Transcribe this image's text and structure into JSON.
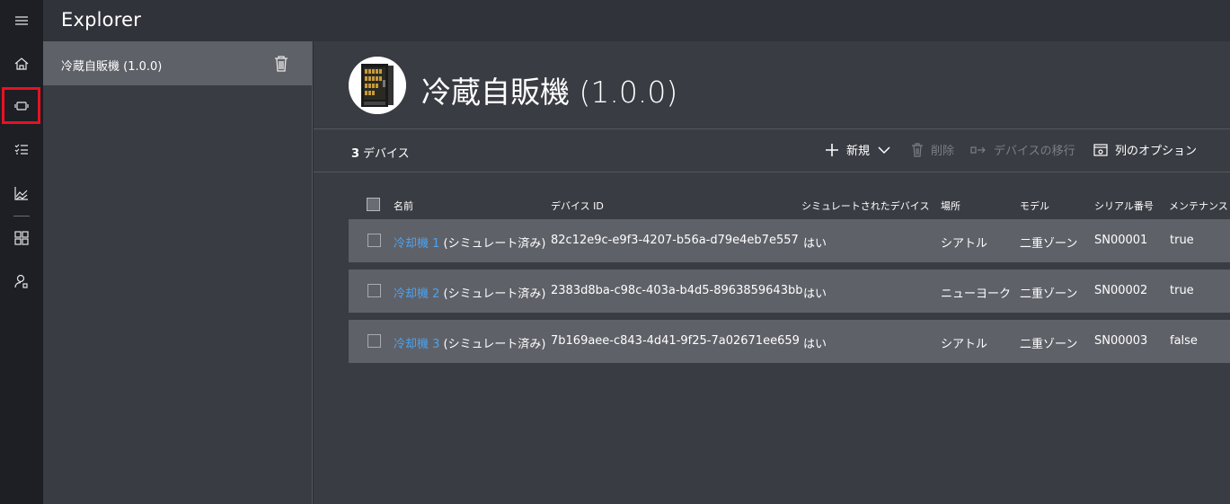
{
  "header": {
    "title": "Explorer"
  },
  "rail": {
    "items": [
      {
        "icon": "menu-icon"
      },
      {
        "icon": "home-icon"
      },
      {
        "icon": "device-icon",
        "selected": true
      },
      {
        "icon": "rules-list-icon"
      },
      {
        "icon": "analytics-chart-icon"
      },
      {
        "icon": "dashboard-grid-icon"
      },
      {
        "icon": "user-admin-icon"
      }
    ],
    "selected_color": "#e81123"
  },
  "templates": {
    "items": [
      {
        "label": "冷蔵自販機 (1.0.0)"
      }
    ]
  },
  "main": {
    "title": "冷蔵自販機 (1.0.0)",
    "toolbar": {
      "count_number": "3",
      "count_label": "デバイス",
      "new_label": "新規",
      "delete_label": "削除",
      "migrate_label": "デバイスの移行",
      "columns_label": "列のオプション"
    },
    "table": {
      "headers": [
        "名前",
        "デバイス ID",
        "シミュレートされたデバイス",
        "場所",
        "モデル",
        "シリアル番号",
        "メンテナンス"
      ],
      "rows": [
        {
          "name": "冷却機 1",
          "suffix": "(シミュレート済み)",
          "device_id": "82c12e9c-e9f3-4207-b56a-d79e4eb7e557",
          "simulated": "はい",
          "location": "シアトル",
          "model": "二重ゾーン",
          "serial": "SN00001",
          "maintenance": "true"
        },
        {
          "name": "冷却機 2",
          "suffix": "(シミュレート済み)",
          "device_id": "2383d8ba-c98c-403a-b4d5-8963859643bb",
          "simulated": "はい",
          "location": "ニューヨーク",
          "model": "二重ゾーン",
          "serial": "SN00002",
          "maintenance": "true"
        },
        {
          "name": "冷却機 3",
          "suffix": "(シミュレート済み)",
          "device_id": "7b169aee-c843-4d41-9f25-7a02671ee659",
          "simulated": "はい",
          "location": "シアトル",
          "model": "二重ゾーン",
          "serial": "SN00003",
          "maintenance": "false"
        }
      ]
    }
  },
  "colors": {
    "link": "#4aa3f0",
    "row_bg": "#5f6168",
    "panel_bg": "#3a3c43",
    "rail_bg": "#1d1f24"
  }
}
